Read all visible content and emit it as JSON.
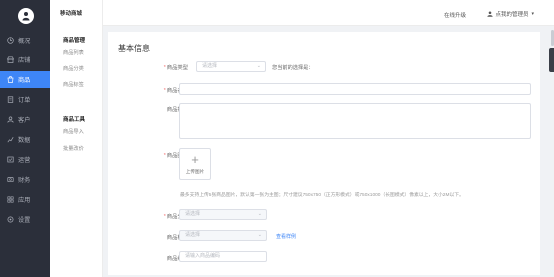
{
  "nav": {
    "items": [
      {
        "label": "概况",
        "icon": "overview-icon"
      },
      {
        "label": "店铺",
        "icon": "store-icon"
      },
      {
        "label": "商品",
        "icon": "goods-icon"
      },
      {
        "label": "订单",
        "icon": "order-icon"
      },
      {
        "label": "客户",
        "icon": "customer-icon"
      },
      {
        "label": "数据",
        "icon": "data-icon"
      },
      {
        "label": "运营",
        "icon": "operation-icon"
      },
      {
        "label": "财务",
        "icon": "finance-icon"
      },
      {
        "label": "应用",
        "icon": "apps-icon"
      },
      {
        "label": "设置",
        "icon": "settings-icon"
      }
    ],
    "active_index": 2,
    "accent": "#3e86f7"
  },
  "sub": {
    "app_name": "移动商城",
    "group1": "商品管理",
    "group1_links": [
      "商品列表",
      "商品分类",
      "商品标签"
    ],
    "group2": "商品工具",
    "group2_links": [
      "商品导入",
      "批量改价"
    ]
  },
  "top": {
    "upgrade": "在线升级",
    "user": "点我的管理员"
  },
  "form": {
    "title": "基本信息",
    "type_label": "商品类型",
    "type_placeholder": "请选择",
    "type_note": "您当前的选择是：",
    "name_label": "商品名称",
    "desc_label": "商品描述",
    "image_label": "商品图片",
    "upload_label": "上传图片",
    "image_hint": "最多支持上传5张商品图片，默认第一张为主图；尺寸建议750x750（正方形模式）或750x1000（长图模式）像素以上，大小2M以下。",
    "category_label": "商品分类",
    "category_placeholder": "请选择",
    "tag_label": "商品标签",
    "tag_placeholder": "请选择",
    "tag_link": "查看样例",
    "code_label": "商品编码",
    "code_placeholder": "请输入商品编码"
  }
}
